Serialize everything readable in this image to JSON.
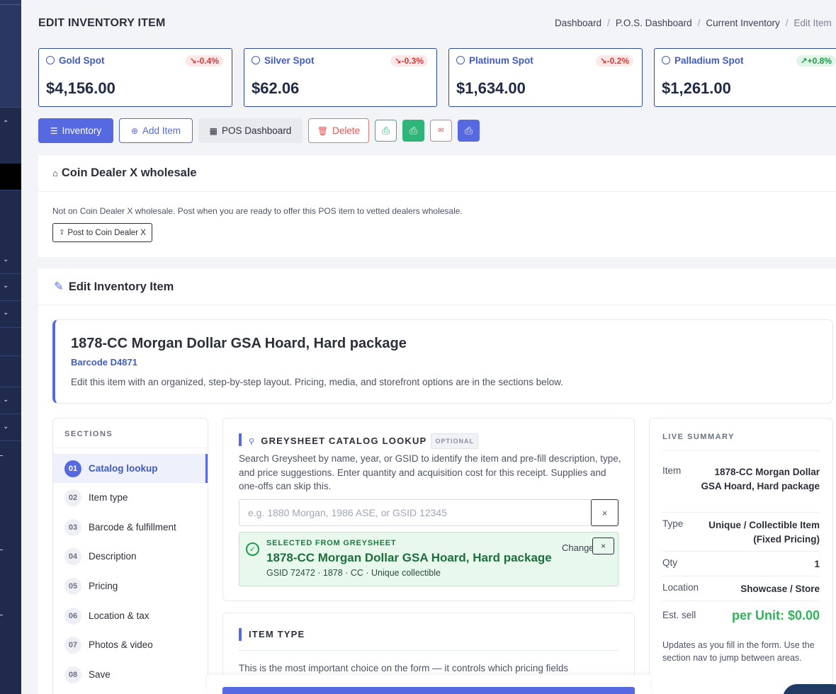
{
  "header": {
    "title": "EDIT INVENTORY ITEM",
    "breadcrumb": [
      "Dashboard",
      "P.O.S. Dashboard",
      "Current Inventory",
      "Edit Item"
    ]
  },
  "spots": [
    {
      "name": "Gold Spot",
      "change": "-0.4%",
      "direction": "down",
      "price": "$4,156.00"
    },
    {
      "name": "Silver Spot",
      "change": "-0.3%",
      "direction": "down",
      "price": "$62.06"
    },
    {
      "name": "Platinum Spot",
      "change": "-0.2%",
      "direction": "down",
      "price": "$1,634.00"
    },
    {
      "name": "Palladium Spot",
      "change": "+0.8%",
      "direction": "up",
      "price": "$1,261.00"
    }
  ],
  "actions": {
    "inventory": "Inventory",
    "add_item": "Add Item",
    "pos_dashboard": "POS Dashboard",
    "delete": "Delete",
    "icon_buttons": [
      "print-icon",
      "print-icon",
      "mail-icon",
      "print-icon"
    ]
  },
  "dealer": {
    "title": "Coin Dealer X wholesale",
    "note": "Not on Coin Dealer X wholesale. Post when you are ready to offer this POS item to vetted dealers wholesale.",
    "post_button": "Post to Coin Dealer X"
  },
  "edit": {
    "title": "Edit Inventory Item",
    "item_title": "1878-CC Morgan Dollar GSA Hoard, Hard package",
    "barcode": "Barcode D4871",
    "description": "Edit this item with an organized, step-by-step layout. Pricing, media, and storefront options are in the sections below."
  },
  "sections": {
    "heading": "SECTIONS",
    "items": [
      {
        "num": "01",
        "label": "Catalog lookup",
        "active": true
      },
      {
        "num": "02",
        "label": "Item type"
      },
      {
        "num": "03",
        "label": "Barcode & fulfillment"
      },
      {
        "num": "04",
        "label": "Description"
      },
      {
        "num": "05",
        "label": "Pricing"
      },
      {
        "num": "06",
        "label": "Location & tax"
      },
      {
        "num": "07",
        "label": "Photos & video"
      },
      {
        "num": "08",
        "label": "Save"
      }
    ]
  },
  "lookup": {
    "title": "GREYSHEET CATALOG LOOKUP",
    "optional": "OPTIONAL",
    "description": "Search Greysheet by name, year, or GSID to identify the item and pre-fill description, type, and price suggestions. Enter quantity and acquisition cost for this receipt. Supplies and one-offs can skip this.",
    "placeholder": "e.g. 1880 Morgan, 1986 ASE, or GSID 12345",
    "clear": "×",
    "selected_label": "SELECTED FROM GREYSHEET",
    "selected_name": "1878-CC Morgan Dollar GSA Hoard, Hard package",
    "selected_meta": "GSID 72472 · 1878 · CC · Unique collectible",
    "change": "Change",
    "remove": "×"
  },
  "item_type": {
    "title": "ITEM TYPE",
    "description": "This is the most important choice on the form — it controls which pricing fields"
  },
  "summary": {
    "heading": "LIVE SUMMARY",
    "rows": [
      {
        "key": "Item",
        "value": "1878-CC Morgan Dollar GSA Hoard, Hard package"
      },
      {
        "key": "Type",
        "value": "Unique / Collectible Item (Fixed Pricing)"
      },
      {
        "key": "Qty",
        "value": "1"
      },
      {
        "key": "Location",
        "value": "Showcase / Store"
      },
      {
        "key": "Est. sell",
        "value": "per Unit: $0.00"
      }
    ],
    "note": "Updates as you fill in the form. Use the section nav to jump between areas."
  },
  "colors": {
    "accent": "#5669e0",
    "success": "#2fb45a",
    "danger": "#e05555",
    "sidebar": "#1f2a4d"
  }
}
